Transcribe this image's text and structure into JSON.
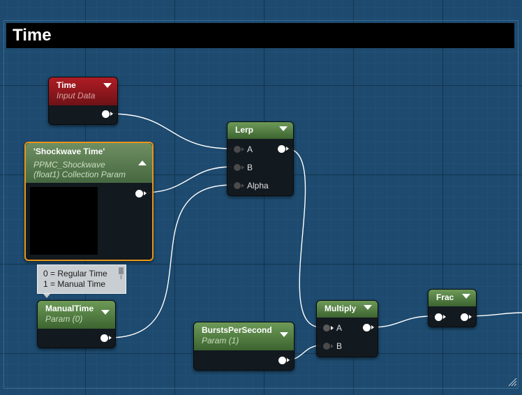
{
  "comment": {
    "title": "Time"
  },
  "nodes": {
    "time": {
      "title": "Time",
      "subtitle": "Input Data"
    },
    "shockwave_time": {
      "title": "'Shockwave Time'",
      "subtitle_line1": "PPMC_Shockwave",
      "subtitle_line2": "(float1) Collection Param"
    },
    "manual_time": {
      "title": "ManualTime",
      "subtitle": "Param (0)"
    },
    "lerp": {
      "title": "Lerp",
      "pins": {
        "a": "A",
        "b": "B",
        "alpha": "Alpha"
      }
    },
    "bursts_per_second": {
      "title": "BurstsPerSecond",
      "subtitle": "Param (1)"
    },
    "multiply": {
      "title": "Multiply",
      "pins": {
        "a": "A",
        "b": "B"
      }
    },
    "frac": {
      "title": "Frac"
    }
  },
  "tooltip": {
    "line1": "0 = Regular Time",
    "line2": "1 = Manual Time"
  },
  "colors": {
    "input_data_header": "#b01c24",
    "param_header": "#6d9a58",
    "selection_outline": "#e8941a",
    "wire": "#ffffff"
  }
}
